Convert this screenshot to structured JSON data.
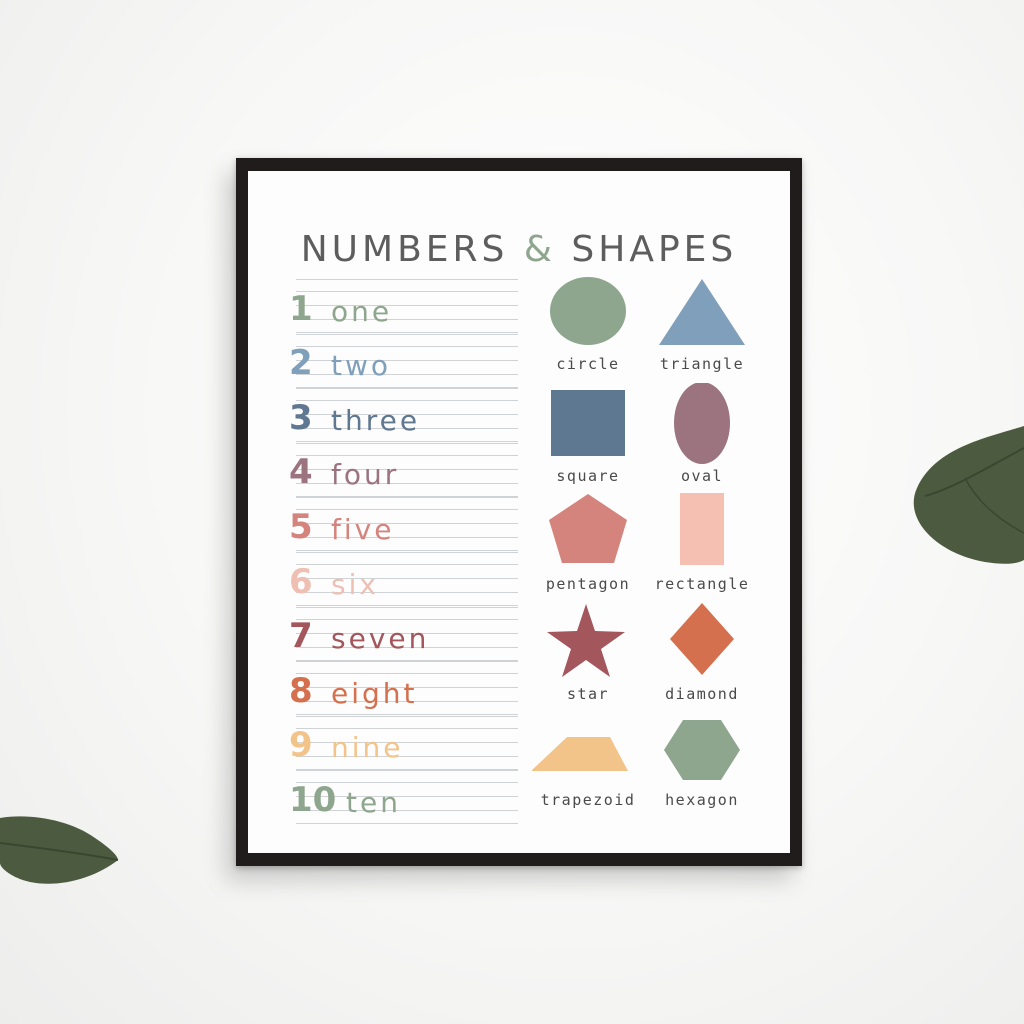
{
  "poster": {
    "title_left": "NUMBERS",
    "title_amp": "&",
    "title_right": "SHAPES",
    "numbers": [
      {
        "digit": "1",
        "word": "one",
        "color": "#8fa68e"
      },
      {
        "digit": "2",
        "word": "two",
        "color": "#7f9fbb"
      },
      {
        "digit": "3",
        "word": "three",
        "color": "#5f7891"
      },
      {
        "digit": "4",
        "word": "four",
        "color": "#9b7480"
      },
      {
        "digit": "5",
        "word": "five",
        "color": "#d4847d"
      },
      {
        "digit": "6",
        "word": "six",
        "color": "#f0bfb3"
      },
      {
        "digit": "7",
        "word": "seven",
        "color": "#a3565c"
      },
      {
        "digit": "8",
        "word": "eight",
        "color": "#d4704d"
      },
      {
        "digit": "9",
        "word": "nine",
        "color": "#f2c48a"
      },
      {
        "digit": "10",
        "word": "ten",
        "color": "#8fa68e"
      }
    ],
    "shapes": [
      {
        "name": "circle",
        "color": "#8fa68e"
      },
      {
        "name": "triangle",
        "color": "#7f9fbb"
      },
      {
        "name": "square",
        "color": "#5f7891"
      },
      {
        "name": "oval",
        "color": "#9b7480"
      },
      {
        "name": "pentagon",
        "color": "#d4847d"
      },
      {
        "name": "rectangle",
        "color": "#f5bfb2"
      },
      {
        "name": "star",
        "color": "#a3565c"
      },
      {
        "name": "diamond",
        "color": "#d4704d"
      },
      {
        "name": "trapezoid",
        "color": "#f2c48a"
      },
      {
        "name": "hexagon",
        "color": "#8fa68e"
      }
    ]
  }
}
